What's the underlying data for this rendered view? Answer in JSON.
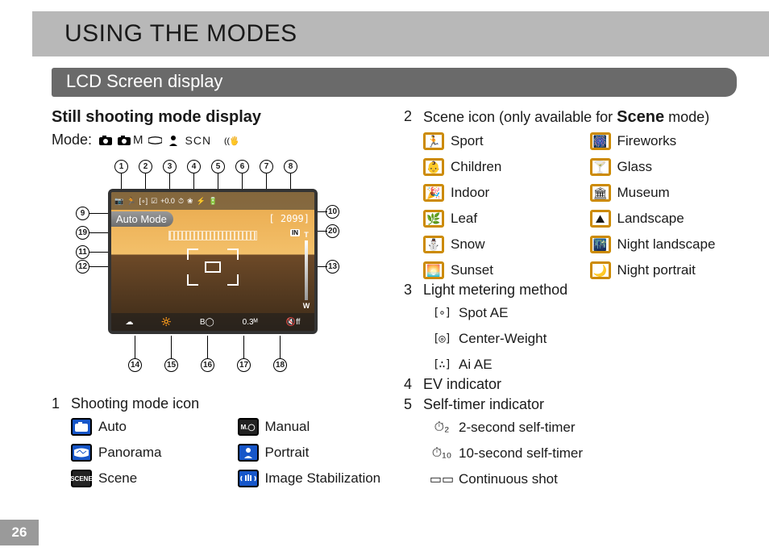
{
  "page_title": "USING THE MODES",
  "section_title": "LCD Screen display",
  "page_number": "26",
  "left": {
    "heading": "Still shooting mode display",
    "mode_label": "Mode:",
    "mode_icons": [
      "camera-icon",
      "camera-m-icon",
      "panorama-icon",
      "portrait-icon",
      "scn-icon",
      "stabilization-icon"
    ],
    "mode_m_suffix": "M",
    "mode_scn_text": "SCN",
    "lcd": {
      "mode_text": "Auto Mode",
      "top_row": [
        "📷",
        "🏃",
        "[∘]",
        "☑",
        "+0.0",
        "⏱",
        "❀",
        "⚡",
        "🔋"
      ],
      "counter": "[  2099]",
      "in_badge": "IN",
      "zoom_top": "T",
      "zoom_bottom": "W",
      "bottom_row": [
        "☁",
        "🔆",
        "B◯",
        "0.3ᴹ",
        "🔇ff"
      ]
    },
    "callouts_top": [
      "1",
      "2",
      "3",
      "4",
      "5",
      "6",
      "7",
      "8"
    ],
    "callouts_left": [
      "9",
      "19",
      "11",
      "12"
    ],
    "callouts_right": [
      "10",
      "20",
      "13"
    ],
    "callouts_bottom": [
      "14",
      "15",
      "16",
      "17",
      "18"
    ],
    "section1": {
      "num": "1",
      "title": "Shooting mode icon",
      "items_left": [
        {
          "icon": "camera-icon",
          "style": "blue",
          "label": "Auto"
        },
        {
          "icon": "panorama-icon",
          "style": "blue",
          "label": "Panorama"
        },
        {
          "icon": "scene-icon",
          "style": "dark",
          "label": "Scene",
          "text": "SCENE"
        }
      ],
      "items_right": [
        {
          "icon": "manual-icon",
          "style": "dark",
          "label": "Manual",
          "text": "M.◯"
        },
        {
          "icon": "portrait-icon",
          "style": "blue",
          "label": "Portrait"
        },
        {
          "icon": "stabilization-icon",
          "style": "blue",
          "label": "Image Stabilization"
        }
      ]
    }
  },
  "right": {
    "section2": {
      "num": "2",
      "title_pre": "Scene icon (only available for ",
      "title_bold": "Scene",
      "title_post": " mode)",
      "items_left": [
        {
          "icon": "sport-icon",
          "label": "Sport"
        },
        {
          "icon": "children-icon",
          "label": "Children"
        },
        {
          "icon": "indoor-icon",
          "label": "Indoor"
        },
        {
          "icon": "leaf-icon",
          "label": "Leaf"
        },
        {
          "icon": "snow-icon",
          "label": "Snow"
        },
        {
          "icon": "sunset-icon",
          "label": "Sunset"
        }
      ],
      "items_right": [
        {
          "icon": "fireworks-icon",
          "label": "Fireworks"
        },
        {
          "icon": "glass-icon",
          "label": "Glass"
        },
        {
          "icon": "museum-icon",
          "label": "Museum"
        },
        {
          "icon": "landscape-icon",
          "label": "Landscape"
        },
        {
          "icon": "night-landscape-icon",
          "label": "Night landscape"
        },
        {
          "icon": "night-portrait-icon",
          "label": "Night portrait"
        }
      ]
    },
    "section3": {
      "num": "3",
      "title": "Light metering method",
      "items": [
        {
          "glyph": "[∘]",
          "label": "Spot AE",
          "name": "spot-ae-icon"
        },
        {
          "glyph": "[◎]",
          "label": "Center-Weight",
          "name": "center-weight-icon"
        },
        {
          "glyph": "[∴]",
          "label": "Ai AE",
          "name": "ai-ae-icon"
        }
      ]
    },
    "section4": {
      "num": "4",
      "title": "EV indicator"
    },
    "section5": {
      "num": "5",
      "title": "Self-timer indicator",
      "items": [
        {
          "glyph": "⏱₂",
          "label": "2-second self-timer",
          "name": "timer-2s-icon"
        },
        {
          "glyph": "⏱₁₀",
          "label": "10-second self-timer",
          "name": "timer-10s-icon"
        },
        {
          "glyph": "▭▭",
          "label": "Continuous shot",
          "name": "continuous-shot-icon"
        }
      ]
    }
  }
}
